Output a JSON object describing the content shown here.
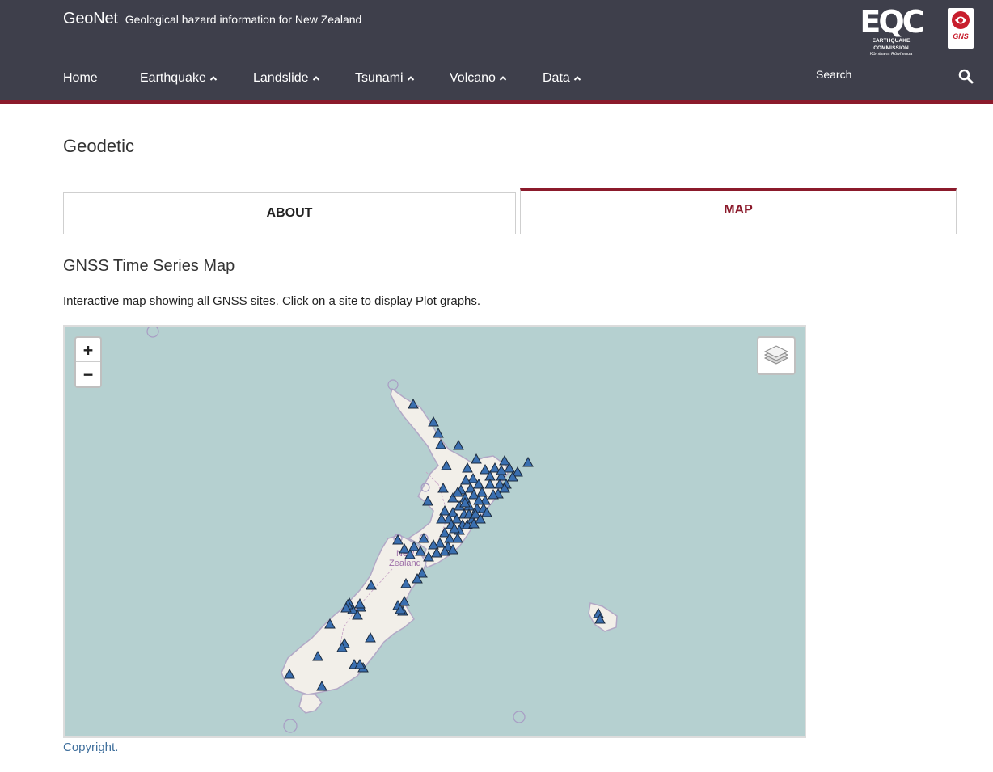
{
  "header": {
    "brand_name": "GeoNet",
    "brand_tagline": "Geological hazard information for New Zealand",
    "eqc_logo_text": "EQC",
    "eqc_logo_sub": "EARTHQUAKE COMMISSION",
    "eqc_logo_sub2": "Kōmihana Rūwhenua",
    "gns_logo_text": "GNS",
    "nav": [
      {
        "label": "Home",
        "has_caret": false
      },
      {
        "label": "Earthquake",
        "has_caret": true
      },
      {
        "label": "Landslide",
        "has_caret": true
      },
      {
        "label": "Tsunami",
        "has_caret": true
      },
      {
        "label": "Volcano",
        "has_caret": true
      },
      {
        "label": "Data",
        "has_caret": true
      }
    ],
    "search_label": "Search",
    "accent_color": "#8b1a2b",
    "background_color": "#3e3f4b"
  },
  "page": {
    "title": "Geodetic",
    "tabs": [
      {
        "label": "ABOUT",
        "active": false
      },
      {
        "label": "MAP",
        "active": true
      }
    ],
    "section_title": "GNSS Time Series Map",
    "section_description": "Interactive map showing all GNSS sites. Click on a site to display Plot graphs.",
    "copyright_link": "Copyright."
  },
  "map": {
    "zoom_in_label": "+",
    "zoom_out_label": "−",
    "layers_icon": "layers-icon",
    "place_label_line1": "New",
    "place_label_line2": "Zealand",
    "marker_icon": "triangle-marker-icon",
    "marker_color": "#3a6fb0",
    "sea_color": "#b5d0d0",
    "land_color": "#f2efe9"
  }
}
